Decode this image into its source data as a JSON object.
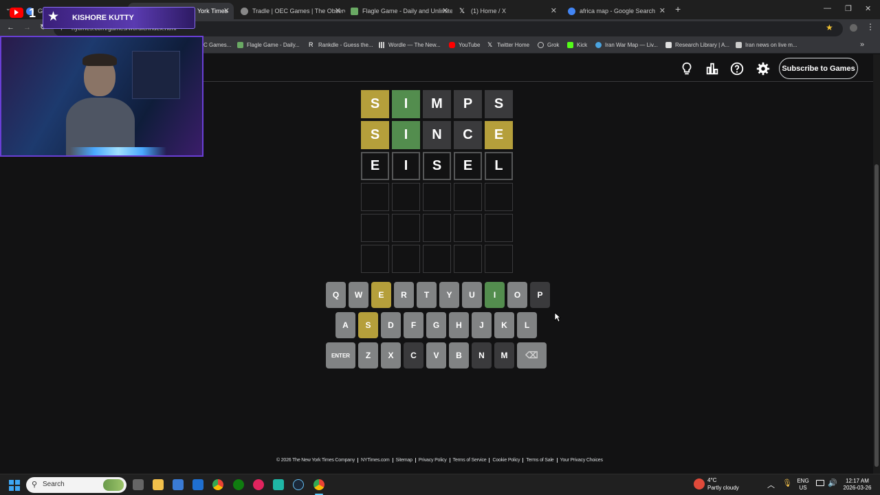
{
  "browser": {
    "tabs": [
      {
        "title": "Goo",
        "favicon_color": "#4285f4"
      },
      {
        "title": "York Times",
        "favicon_color": "#ffffff"
      },
      {
        "title": "Tradle | OEC Games | The Observ",
        "favicon_color": "#888888"
      },
      {
        "title": "Flagle Game - Daily and Unlimite",
        "favicon_color": "#6aaa64"
      },
      {
        "title": "(1) Home / X",
        "favicon_color": "#ffffff"
      },
      {
        "title": "africa map - Google Search",
        "favicon_color": "#4285f4"
      }
    ],
    "url": "nytimes.com/games/wordle/index.html",
    "bookmarks": [
      {
        "label": "C Games...",
        "icon_color": "#888888"
      },
      {
        "label": "Flagle Game - Daily...",
        "icon_color": "#6aaa64"
      },
      {
        "label": "Rankdle - Guess the...",
        "icon_color": "#ffffff"
      },
      {
        "label": "Wordle — The New...",
        "icon_color": "#cfcfcf"
      },
      {
        "label": "YouTube",
        "icon_color": "#ff0000"
      },
      {
        "label": "Twitter Home",
        "icon_color": "#ffffff"
      },
      {
        "label": "Grok",
        "icon_color": "#cccccc"
      },
      {
        "label": "Kick",
        "icon_color": "#53fc18"
      },
      {
        "label": "Iran War Map — Liv...",
        "icon_color": "#4aa3df"
      },
      {
        "label": "Research Library | A...",
        "icon_color": "#e0e0e0"
      },
      {
        "label": "Iran news on live m...",
        "icon_color": "#cccccc"
      }
    ]
  },
  "overlay": {
    "streamer_name": "KISHORE KUTTY",
    "yt_count": "1"
  },
  "header": {
    "subscribe_label": "Subscribe to Games",
    "icons": [
      "lightbulb-icon",
      "stats-icon",
      "help-icon",
      "settings-icon"
    ]
  },
  "board": {
    "rows": [
      {
        "letters": [
          "S",
          "I",
          "M",
          "P",
          "S"
        ],
        "states": [
          "present",
          "correct",
          "absent",
          "absent",
          "absent"
        ]
      },
      {
        "letters": [
          "S",
          "I",
          "N",
          "C",
          "E"
        ],
        "states": [
          "present",
          "correct",
          "absent",
          "absent",
          "present"
        ]
      },
      {
        "letters": [
          "E",
          "I",
          "S",
          "E",
          "L"
        ],
        "states": [
          "tbd",
          "tbd",
          "tbd",
          "tbd",
          "tbd"
        ]
      },
      {
        "letters": [
          "",
          "",
          "",
          "",
          ""
        ],
        "states": [
          "empty",
          "empty",
          "empty",
          "empty",
          "empty"
        ]
      },
      {
        "letters": [
          "",
          "",
          "",
          "",
          ""
        ],
        "states": [
          "empty",
          "empty",
          "empty",
          "empty",
          "empty"
        ]
      },
      {
        "letters": [
          "",
          "",
          "",
          "",
          ""
        ],
        "states": [
          "empty",
          "empty",
          "empty",
          "empty",
          "empty"
        ]
      }
    ]
  },
  "keyboard": {
    "rows": [
      [
        {
          "k": "Q",
          "s": "unused"
        },
        {
          "k": "W",
          "s": "unused"
        },
        {
          "k": "E",
          "s": "present"
        },
        {
          "k": "R",
          "s": "unused"
        },
        {
          "k": "T",
          "s": "unused"
        },
        {
          "k": "Y",
          "s": "unused"
        },
        {
          "k": "U",
          "s": "unused"
        },
        {
          "k": "I",
          "s": "correct"
        },
        {
          "k": "O",
          "s": "unused"
        },
        {
          "k": "P",
          "s": "absent"
        }
      ],
      [
        {
          "k": "A",
          "s": "unused"
        },
        {
          "k": "S",
          "s": "present"
        },
        {
          "k": "D",
          "s": "unused"
        },
        {
          "k": "F",
          "s": "unused"
        },
        {
          "k": "G",
          "s": "unused"
        },
        {
          "k": "H",
          "s": "unused"
        },
        {
          "k": "J",
          "s": "unused"
        },
        {
          "k": "K",
          "s": "unused"
        },
        {
          "k": "L",
          "s": "unused"
        }
      ],
      [
        {
          "k": "ENTER",
          "s": "unused"
        },
        {
          "k": "Z",
          "s": "unused"
        },
        {
          "k": "X",
          "s": "unused"
        },
        {
          "k": "C",
          "s": "absent"
        },
        {
          "k": "V",
          "s": "unused"
        },
        {
          "k": "B",
          "s": "unused"
        },
        {
          "k": "N",
          "s": "absent"
        },
        {
          "k": "M",
          "s": "absent"
        },
        {
          "k": "⌫",
          "s": "unused"
        }
      ]
    ]
  },
  "footer": {
    "links": [
      "© 2026 The New York Times Company",
      "NYTimes.com",
      "Sitemap",
      "Privacy Policy",
      "Terms of Service",
      "Cookie Policy",
      "Terms of Sale",
      "Your Privacy Choices"
    ]
  },
  "taskbar": {
    "search_placeholder": "Search",
    "weather_temp": "4°C",
    "weather_desc": "Partly cloudy",
    "lang_line1": "ENG",
    "lang_line2": "US",
    "time": "12:17 AM",
    "date": "2026-03-26"
  },
  "colors": {
    "present": "#b59f3b",
    "correct": "#538d4e",
    "absent": "#3a3a3c",
    "unused_key": "#818384",
    "background": "#121213"
  }
}
